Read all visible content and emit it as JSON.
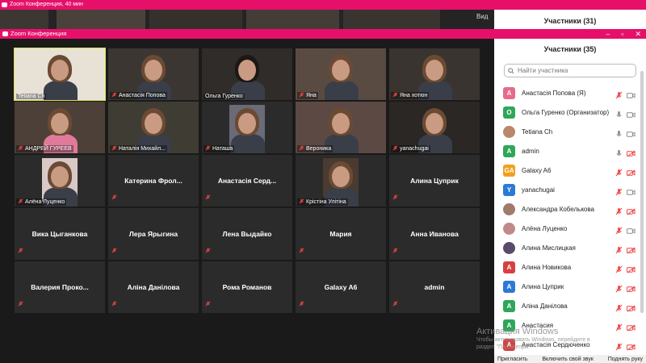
{
  "bg_window": {
    "title": "Zoom Конференция, 40 мин",
    "view_label": "Вид",
    "panel_title": "Участники (31)"
  },
  "window": {
    "title": "Zoom Конференция"
  },
  "tiles": [
    {
      "name": "Tetiana Ch",
      "video": true,
      "active": true,
      "muted": false
    },
    {
      "name": "Анастасія Попова",
      "video": true,
      "muted": true
    },
    {
      "name": "Ольга Гуренко",
      "video": true,
      "muted": false
    },
    {
      "name": "Яна",
      "video": true,
      "muted": true
    },
    {
      "name": "Яна хотюн",
      "video": true,
      "muted": true
    },
    {
      "name": "АНДРЕЙ ГУРЕЕВ",
      "video": true,
      "muted": true
    },
    {
      "name": "Наталія Михайл...",
      "video": true,
      "muted": true
    },
    {
      "name": "Наташа",
      "video": true,
      "muted": true
    },
    {
      "name": "Вероника",
      "video": true,
      "muted": true
    },
    {
      "name": "yanachugai",
      "video": true,
      "muted": true
    },
    {
      "name": "Алёна Луценко",
      "video": true,
      "muted": true
    },
    {
      "name": "Катерина  Фрол...",
      "video": false,
      "muted": true
    },
    {
      "name": "Анастасія  Серд...",
      "video": false,
      "muted": true
    },
    {
      "name": "Крістіна Улітіна",
      "video": true,
      "muted": true
    },
    {
      "name": "Алина Цуприк",
      "video": false,
      "muted": true
    },
    {
      "name": "Вика Цыганкова",
      "video": false,
      "muted": true
    },
    {
      "name": "Лера Ярыгина",
      "video": false,
      "muted": true
    },
    {
      "name": "Лена Выдайко",
      "video": false,
      "muted": true
    },
    {
      "name": "Мария",
      "video": false,
      "muted": true
    },
    {
      "name": "Анна Иванова",
      "video": false,
      "muted": true
    },
    {
      "name": "Валерия  Проко...",
      "video": false,
      "muted": true
    },
    {
      "name": "Аліна Данілова",
      "video": false,
      "muted": true
    },
    {
      "name": "Рома Романов",
      "video": false,
      "muted": true
    },
    {
      "name": "Galaxy A6",
      "video": false,
      "muted": true
    },
    {
      "name": "admin",
      "video": false,
      "muted": true
    }
  ],
  "panel": {
    "title": "Участники (35)",
    "search_placeholder": "Найти участника",
    "participants": [
      {
        "name": "Анастасія Попова (Я)",
        "avatar": "A",
        "color": "#e86a8a",
        "mic": "muted",
        "cam": "on"
      },
      {
        "name": "Ольга Гуренко (Организатор)",
        "avatar": "O",
        "color": "#2fa65a",
        "mic": "on",
        "cam": "on"
      },
      {
        "name": "Tetiana Ch",
        "avatar": "photo",
        "color": "#b9876a",
        "mic": "on",
        "cam": "on"
      },
      {
        "name": "admin",
        "avatar": "A",
        "color": "#2fa65a",
        "mic": "on",
        "cam": "off"
      },
      {
        "name": "Galaxy A6",
        "avatar": "GA",
        "color": "#f0a020",
        "mic": "muted",
        "cam": "off"
      },
      {
        "name": "yanachugai",
        "avatar": "Y",
        "color": "#2d7ad6",
        "mic": "muted",
        "cam": "on"
      },
      {
        "name": "Александра Кобелькова",
        "avatar": "photo",
        "color": "#a07a6a",
        "mic": "muted",
        "cam": "off"
      },
      {
        "name": "Алёна Луценко",
        "avatar": "photo",
        "color": "#c08a8a",
        "mic": "muted",
        "cam": "on"
      },
      {
        "name": "Алина Мислицкая",
        "avatar": "photo",
        "color": "#5a4a6a",
        "mic": "muted",
        "cam": "off"
      },
      {
        "name": "Алина Новикова",
        "avatar": "A",
        "color": "#d84040",
        "mic": "muted",
        "cam": "off"
      },
      {
        "name": "Алина Цуприк",
        "avatar": "A",
        "color": "#2d7ad6",
        "mic": "muted",
        "cam": "off"
      },
      {
        "name": "Аліна Данілова",
        "avatar": "A",
        "color": "#2fa65a",
        "mic": "muted",
        "cam": "off"
      },
      {
        "name": "Анастасия",
        "avatar": "A",
        "color": "#2fa65a",
        "mic": "muted",
        "cam": "off"
      },
      {
        "name": "Анастасія Сердюченко",
        "avatar": "A",
        "color": "#d84040",
        "mic": "muted",
        "cam": "off"
      }
    ]
  },
  "bottom": {
    "invite": "Пригласить",
    "unmute_me": "Включить свой звук",
    "raise_hand": "Поднять руку"
  },
  "watermark": {
    "line1": "Активация Windows",
    "line2": "Чтобы активировать Windows, перейдите в",
    "line3": "раздел \"Параметры\"."
  }
}
